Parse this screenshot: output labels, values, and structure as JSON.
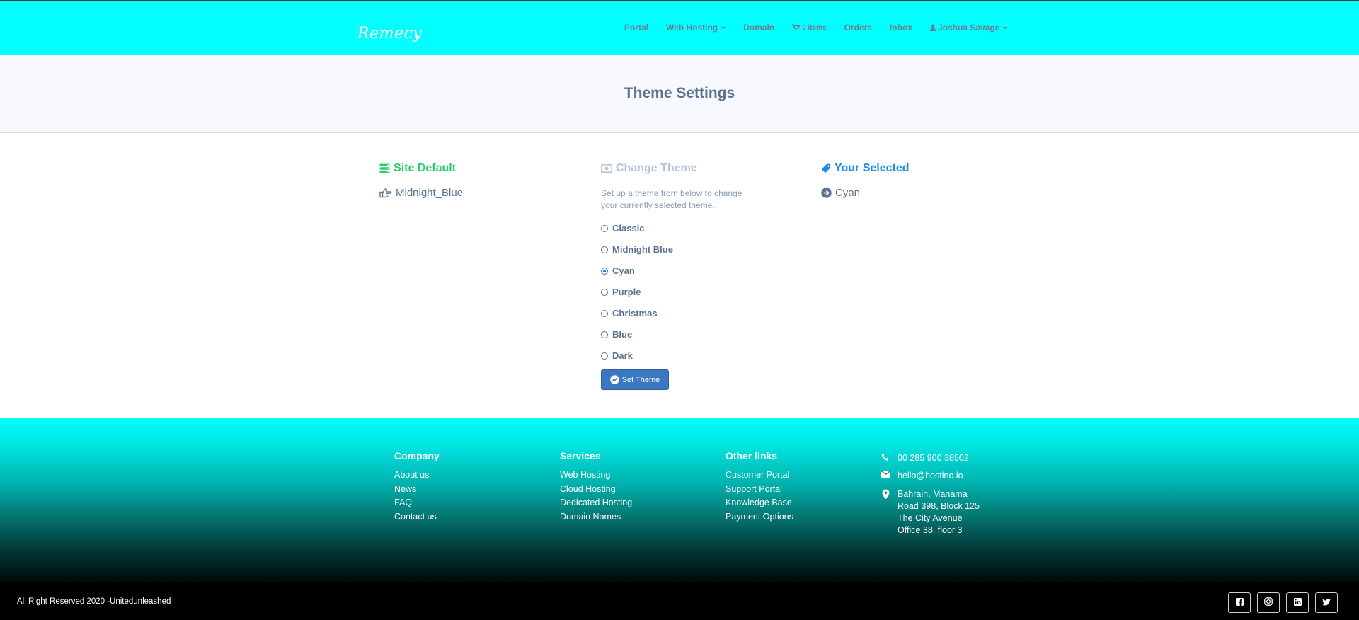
{
  "brand": {
    "logo_text": "Remecy"
  },
  "nav": {
    "items": [
      {
        "label": "Portal"
      },
      {
        "label": "Web Hosting"
      },
      {
        "label": "Domain"
      },
      {
        "label": "0 items"
      },
      {
        "label": "Orders"
      },
      {
        "label": "Inbox"
      },
      {
        "label": "Joshua Savage"
      }
    ]
  },
  "page": {
    "title": "Theme Settings"
  },
  "site_default": {
    "heading": "Site Default",
    "value": "Midnight_Blue",
    "heading_color": "#2ecc71"
  },
  "change_theme": {
    "heading": "Change Theme",
    "help": "Set up a theme from below to change your currently selected theme.",
    "options": [
      {
        "label": "Classic",
        "checked": false
      },
      {
        "label": "Midnight Blue",
        "checked": false
      },
      {
        "label": "Cyan",
        "checked": true
      },
      {
        "label": "Purple",
        "checked": false
      },
      {
        "label": "Christmas",
        "checked": false
      },
      {
        "label": "Blue",
        "checked": false
      },
      {
        "label": "Dark",
        "checked": false
      }
    ],
    "button_label": "Set Theme"
  },
  "your_selected": {
    "heading": "Your Selected",
    "value": "Cyan",
    "heading_color": "#1c8ae6"
  },
  "footer": {
    "company": {
      "heading": "Company",
      "links": [
        "About us",
        "News",
        "FAQ",
        "Contact us"
      ]
    },
    "services": {
      "heading": "Services",
      "links": [
        "Web Hosting",
        "Cloud Hosting",
        "Dedicated Hosting",
        "Domain Names"
      ]
    },
    "other": {
      "heading": "Other links",
      "links": [
        "Customer Portal",
        "Support Portal",
        "Knowledge Base",
        "Payment Options"
      ]
    },
    "contact": {
      "phone": "00 285 900 38502",
      "email": "hello@hostino.io",
      "address": [
        "Bahrain, Manama",
        "Road 398, Block 125",
        "The City Avenue",
        "Office 38, floor 3"
      ]
    },
    "copyright": "All Right Reserved 2020 -Unitedunleashed",
    "social": [
      "facebook-icon",
      "instagram-icon",
      "linkedin-icon",
      "twitter-icon"
    ]
  },
  "colors": {
    "topbar": "#00ffff",
    "title_text": "#5b7392",
    "button": "#3a79c1"
  }
}
